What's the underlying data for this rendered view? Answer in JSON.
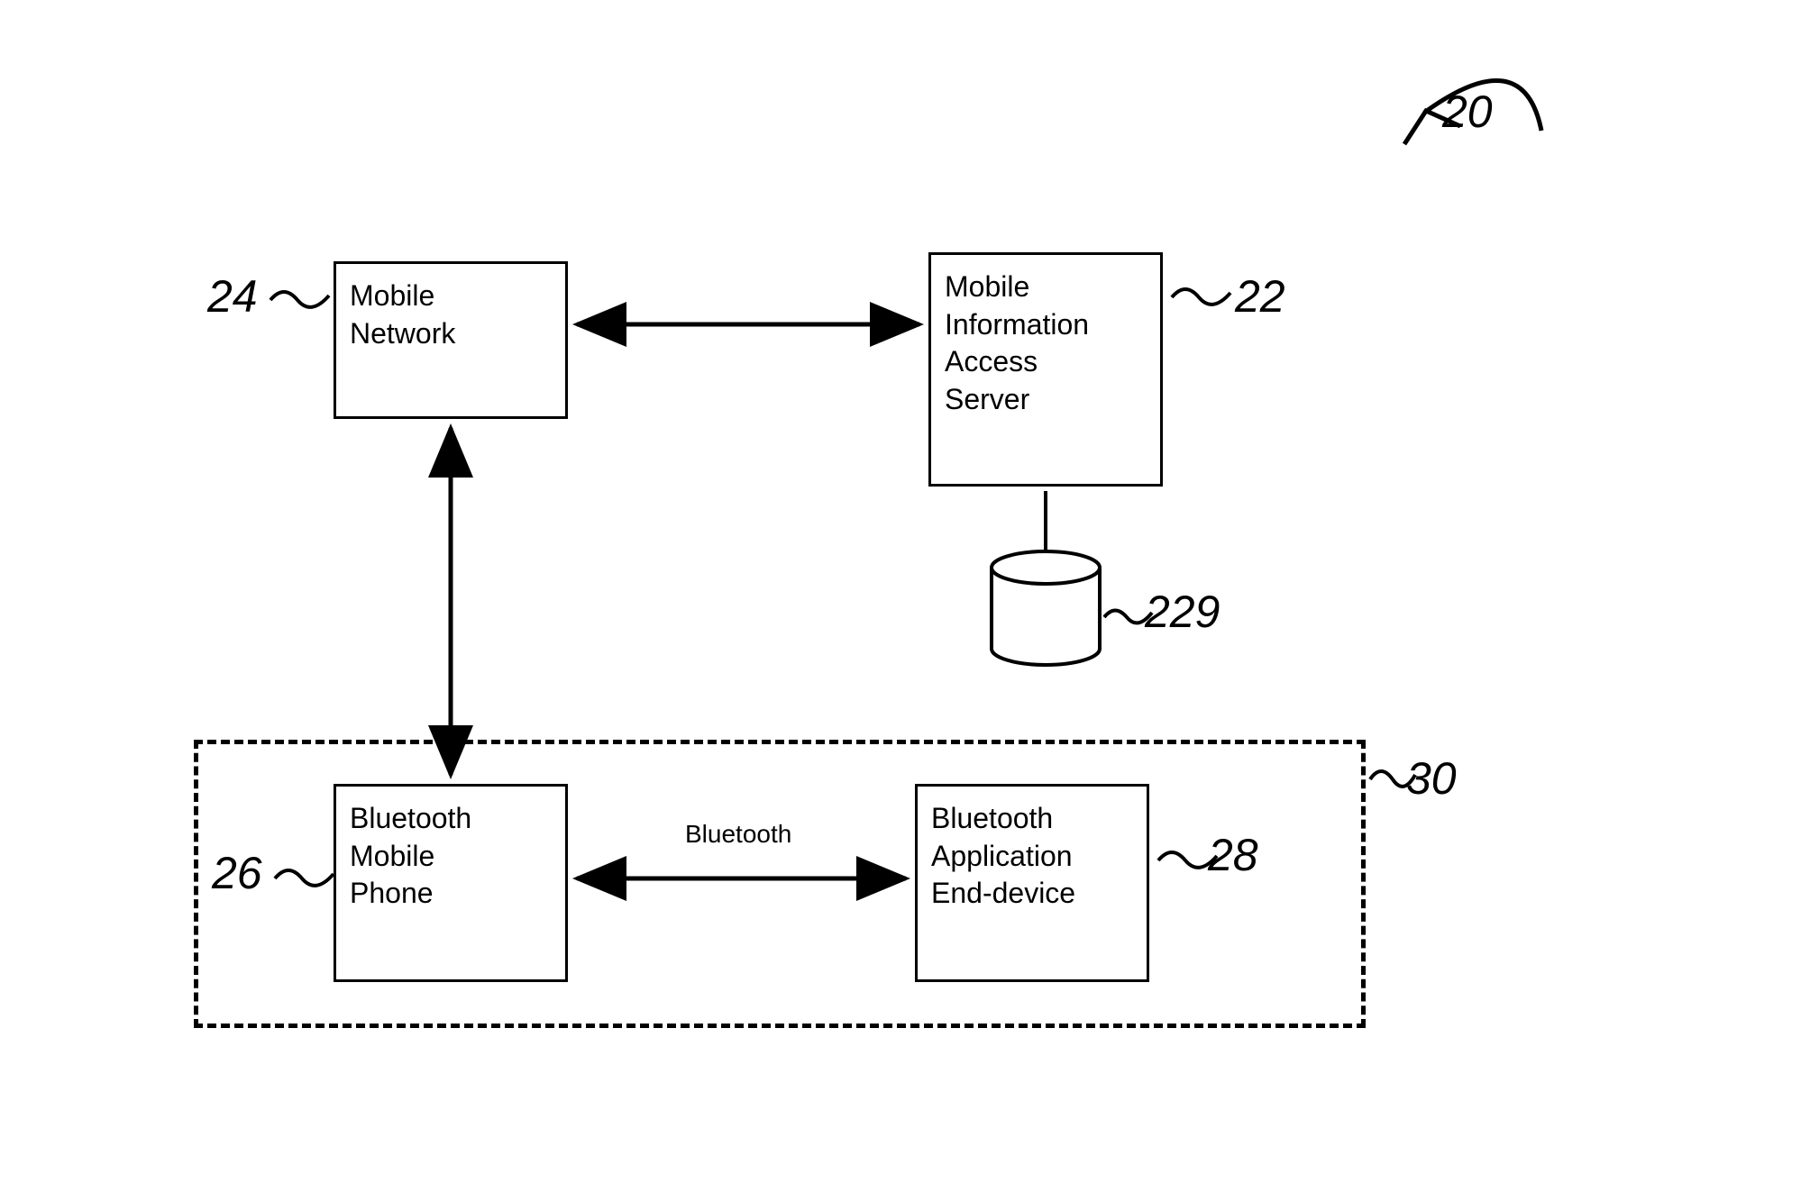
{
  "nodes": {
    "mobile_network": {
      "label": "Mobile\nNetwork",
      "ref": "24"
    },
    "mobile_info_server": {
      "label": "Mobile\nInformation\nAccess\nServer",
      "ref": "22"
    },
    "database": {
      "ref": "229"
    },
    "bt_phone": {
      "label": "Bluetooth\nMobile\nPhone",
      "ref": "26"
    },
    "bt_end_device": {
      "label": "Bluetooth\nApplication\nEnd-device",
      "ref": "28"
    },
    "user_group": {
      "ref": "30"
    },
    "system": {
      "ref": "20"
    }
  },
  "connectors": {
    "bluetooth": {
      "label": "Bluetooth"
    }
  }
}
